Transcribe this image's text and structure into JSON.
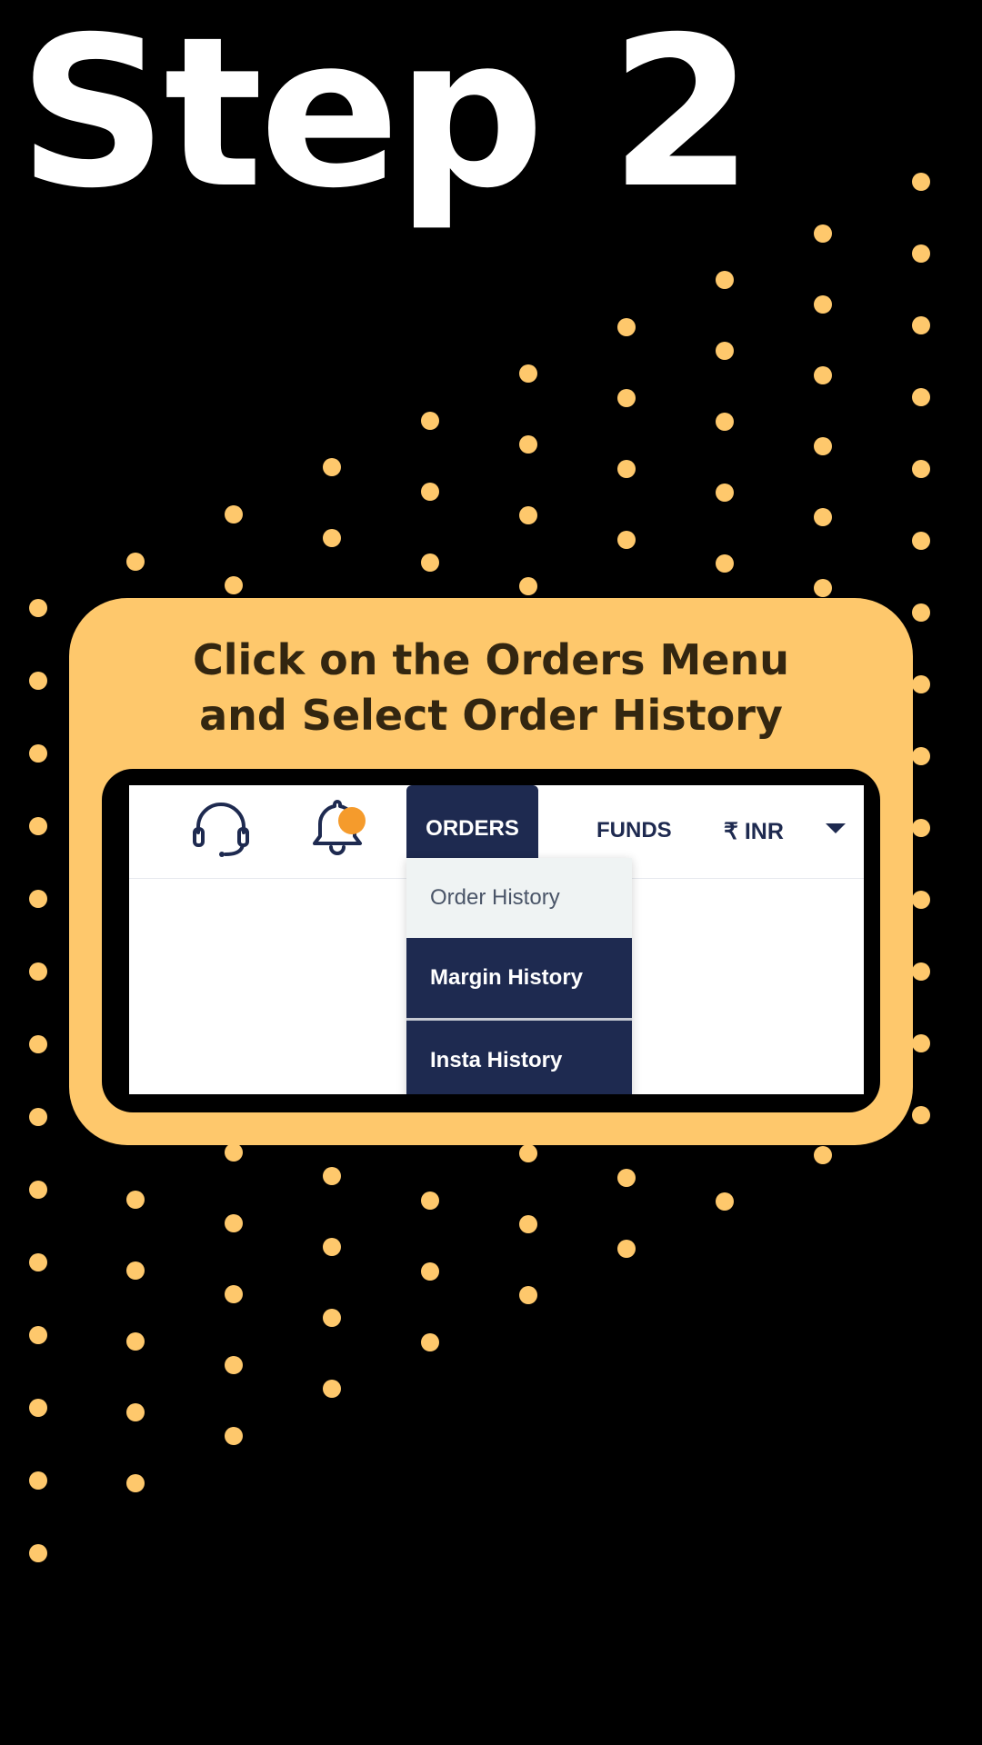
{
  "step_title": "Step 2",
  "instruction": {
    "line1": "Click on the Orders Menu",
    "line2": "and Select Order History"
  },
  "colors": {
    "background": "#000000",
    "accent": "#fec86c",
    "instruction_text": "#332610",
    "nav_dark": "#1e2a50",
    "notification": "#f59b2c"
  },
  "navbar": {
    "support_icon": "headset-icon",
    "notification_icon": "bell-icon",
    "orders_label": "ORDERS",
    "funds_label": "FUNDS",
    "currency_label": "₹ INR",
    "dropdown_icon": "caret-down-icon"
  },
  "orders_menu": {
    "items": [
      {
        "label": "Order History",
        "highlighted": true
      },
      {
        "label": "Margin History",
        "highlighted": false
      },
      {
        "label": "Insta History",
        "highlighted": false
      }
    ]
  }
}
